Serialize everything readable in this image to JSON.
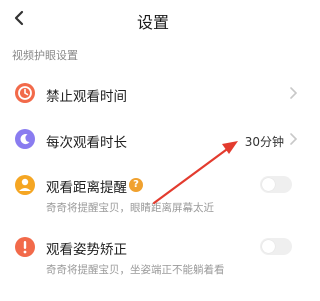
{
  "header": {
    "title": "设置",
    "back_icon": "chevron-left-icon"
  },
  "section": {
    "label": "视频护眼设置"
  },
  "items": [
    {
      "label": "禁止观看时间",
      "icon": "clock-block-icon",
      "color": "#f26a4a"
    },
    {
      "label": "每次观看时长",
      "icon": "moon-icon",
      "color": "#8a7cf0",
      "value": "30分钟"
    },
    {
      "label": "观看距离提醒",
      "icon": "person-distance-icon",
      "color": "#f5a623",
      "help": "?",
      "sub": "奇奇将提醒宝贝，眼睛距离屏幕太近",
      "toggle_on": false
    },
    {
      "label": "观看姿势矫正",
      "icon": "posture-alert-icon",
      "color": "#f26a4a",
      "sub": "奇奇将提醒宝贝，坐姿端正不能躺着看",
      "toggle_on": false
    }
  ],
  "colors": {
    "annotation_arrow": "#e33b2e"
  }
}
